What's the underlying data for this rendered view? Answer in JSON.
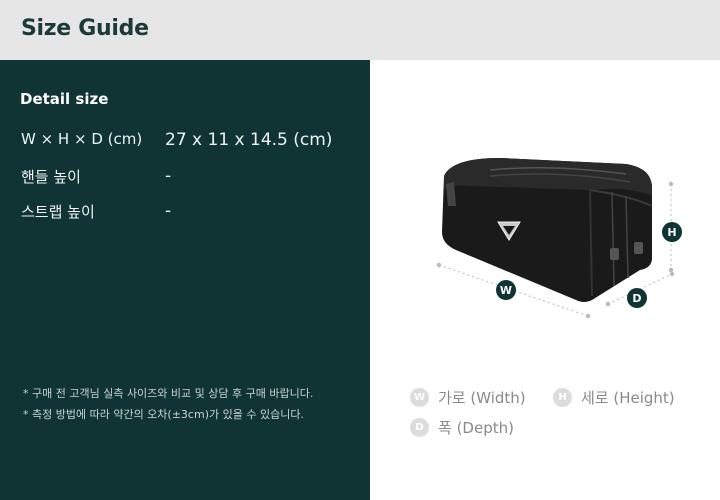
{
  "header": {
    "title": "Size Guide"
  },
  "detail": {
    "title": "Detail size",
    "rows": [
      {
        "label": "W × H × D (cm)",
        "value": "27 x 11 x 14.5 (cm)"
      },
      {
        "label": "핸들 높이",
        "value": "-"
      },
      {
        "label": "스트랩 높이",
        "value": "-"
      }
    ],
    "notes": [
      "* 구매 전 고객님 실측 사이즈와 비교 및 상담 후 구매 바랍니다.",
      "* 측정 방법에 따라 약간의 오차(±3cm)가 있을 수 있습니다."
    ]
  },
  "diagram": {
    "badges": {
      "w": "W",
      "h": "H",
      "d": "D"
    }
  },
  "legend": [
    {
      "badge": "W",
      "label": "가로 (Width)"
    },
    {
      "badge": "H",
      "label": "세로 (Height)"
    },
    {
      "badge": "D",
      "label": "폭 (Depth)"
    }
  ],
  "colors": {
    "panel": "#0f3433",
    "header_bg": "#e6e6e6",
    "badge_dark": "#0f3433",
    "legend_badge": "#dcdcdc"
  }
}
